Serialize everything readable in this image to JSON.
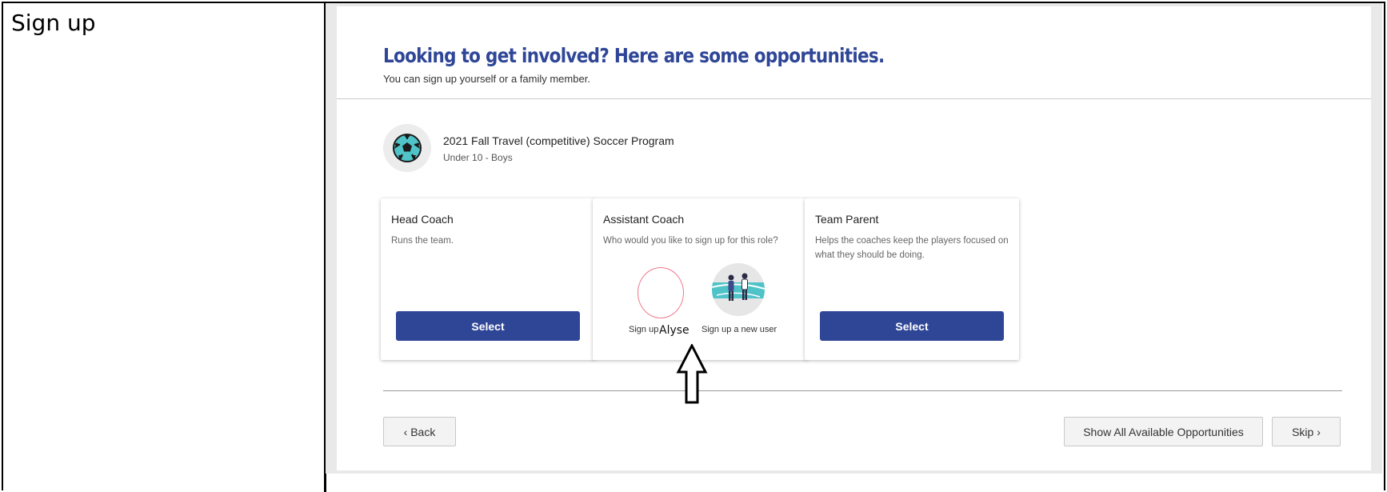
{
  "annotation": {
    "left_label": "Sign up",
    "assistant_user_name": "Alyse"
  },
  "header": {
    "title": "Looking to get involved? Here are some opportunities.",
    "subtitle": "You can sign up yourself or a family member."
  },
  "program": {
    "icon": "soccer-ball-icon",
    "title": "2021 Fall Travel (competitive) Soccer Program",
    "subtitle": "Under 10 - Boys"
  },
  "roles": [
    {
      "title": "Head Coach",
      "description": "Runs the team.",
      "button_label": "Select"
    },
    {
      "title": "Assistant Coach",
      "description": "Who would you like to sign up for this role?",
      "option_self_label": "Sign up",
      "option_new_label": "Sign up a new user"
    },
    {
      "title": "Team Parent",
      "description": "Helps the coaches keep the players focused on what they should be doing.",
      "button_label": "Select"
    }
  ],
  "footer": {
    "back_label": "‹ Back",
    "show_all_label": "Show All Available Opportunities",
    "skip_label": "Skip ›"
  },
  "colors": {
    "brand": "#2f4697",
    "accent": "#4fc3c8",
    "highlight_circle": "#f07a8e"
  }
}
